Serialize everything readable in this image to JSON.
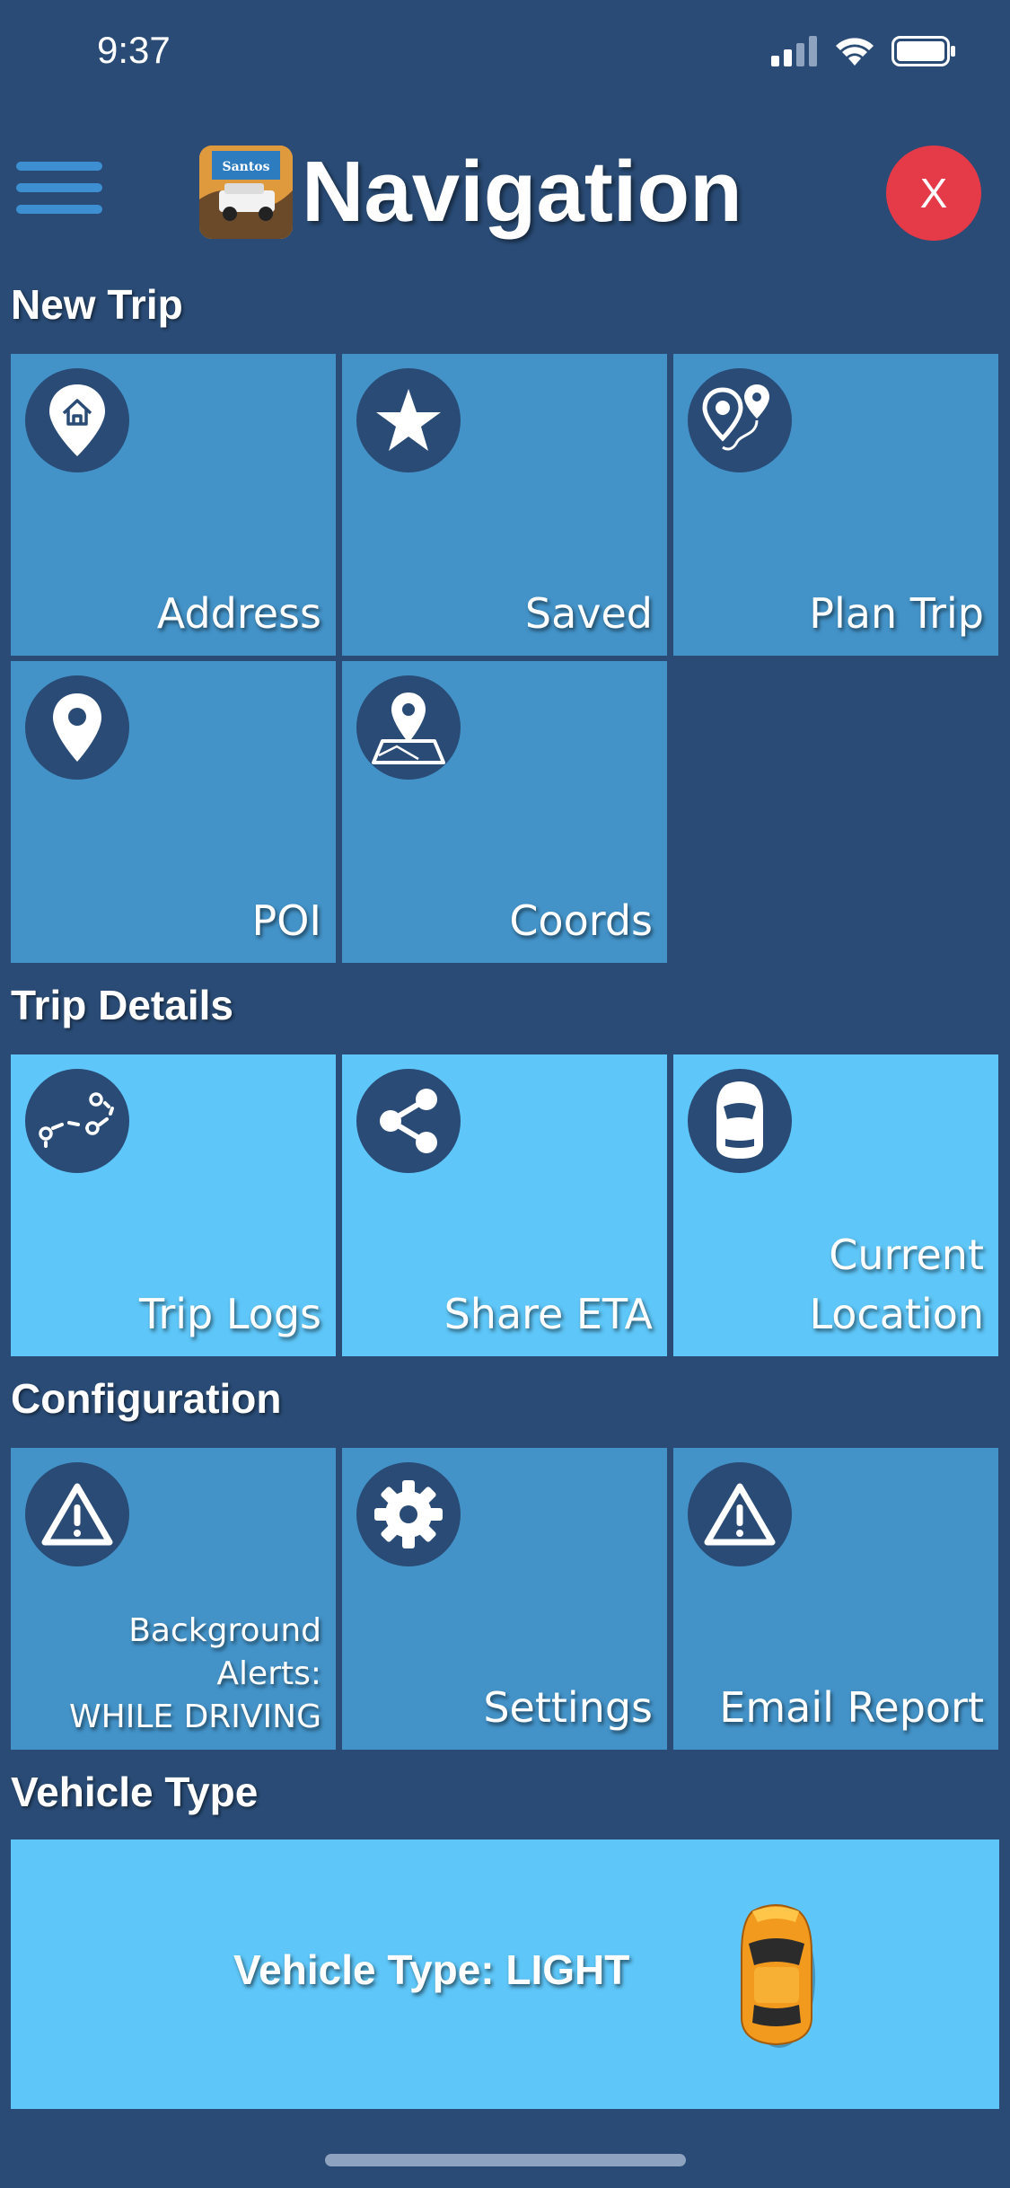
{
  "status": {
    "time": "9:37"
  },
  "header": {
    "title": "Navigation",
    "close_label": "X",
    "logo_text": "Santos"
  },
  "sections": {
    "new_trip": "New Trip",
    "trip_details": "Trip Details",
    "configuration": "Configuration",
    "vehicle_type": "Vehicle Type"
  },
  "new_trip": [
    {
      "label": "Address",
      "icon": "home-pin-icon"
    },
    {
      "label": "Saved",
      "icon": "star-icon"
    },
    {
      "label": "Plan Trip",
      "icon": "route-pins-icon"
    },
    {
      "label": "POI",
      "icon": "location-pin-icon"
    },
    {
      "label": "Coords",
      "icon": "map-pin-icon"
    }
  ],
  "trip_details": [
    {
      "label": "Trip Logs",
      "icon": "dotted-route-icon"
    },
    {
      "label": "Share ETA",
      "icon": "share-icon"
    },
    {
      "label_line1": "Current",
      "label_line2": "Location",
      "icon": "car-top-icon"
    }
  ],
  "configuration": [
    {
      "label_line1": "Background",
      "label_line2": "Alerts:",
      "label_line3": "WHILE DRIVING",
      "icon": "warning-icon"
    },
    {
      "label": "Settings",
      "icon": "gear-icon"
    },
    {
      "label": "Email Report",
      "icon": "warning-icon"
    }
  ],
  "vehicle": {
    "label": "Vehicle Type: LIGHT",
    "icon": "yellow-car-icon"
  },
  "colors": {
    "background": "#294b75",
    "tile_dark": "#4393c9",
    "tile_light": "#5ec6f8",
    "close": "#e53a48",
    "menu": "#3d8fd1"
  }
}
